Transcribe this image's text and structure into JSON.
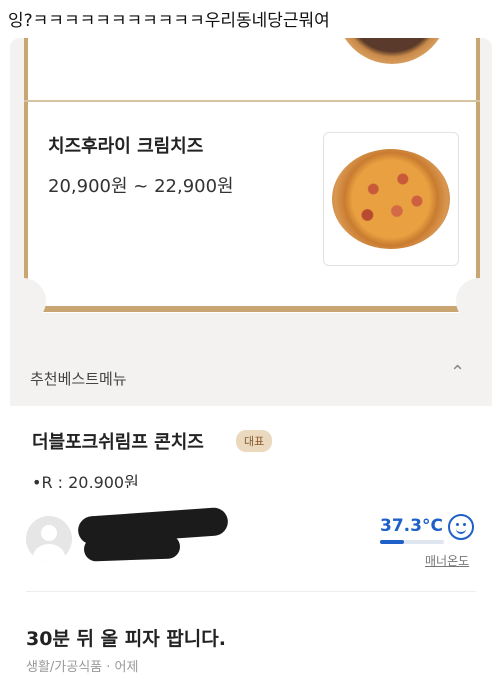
{
  "caption": "잉?ㅋㅋㅋㅋㅋㅋㅋㅋㅋㅋㅋ우리동네당근뭐여",
  "menu_app": {
    "featured_item": {
      "name": "치즈후라이 크림치즈",
      "price_range": "20,900원 ~ 22,900원"
    },
    "section": {
      "title": "추천베스트메뉴"
    },
    "recommended_item": {
      "name": "더블포크쉬림프 콘치즈",
      "badge": "대표",
      "price": "•R : 20,900원"
    },
    "icons": {
      "back": "arrow-left-icon",
      "share": "share-icon",
      "more": "more-icon",
      "collapse": "chevron-up-icon"
    }
  },
  "marketplace": {
    "seller": {
      "temperature": "37.3°C",
      "temperature_fill_percent": 37,
      "manner_label": "매너온도"
    },
    "post": {
      "title": "30분 뒤 올 피자 팝니다.",
      "meta": "생활/가공식품 · 어제"
    },
    "colors": {
      "accent_blue": "#1e60c8",
      "gold_frame": "#c9a571"
    }
  }
}
